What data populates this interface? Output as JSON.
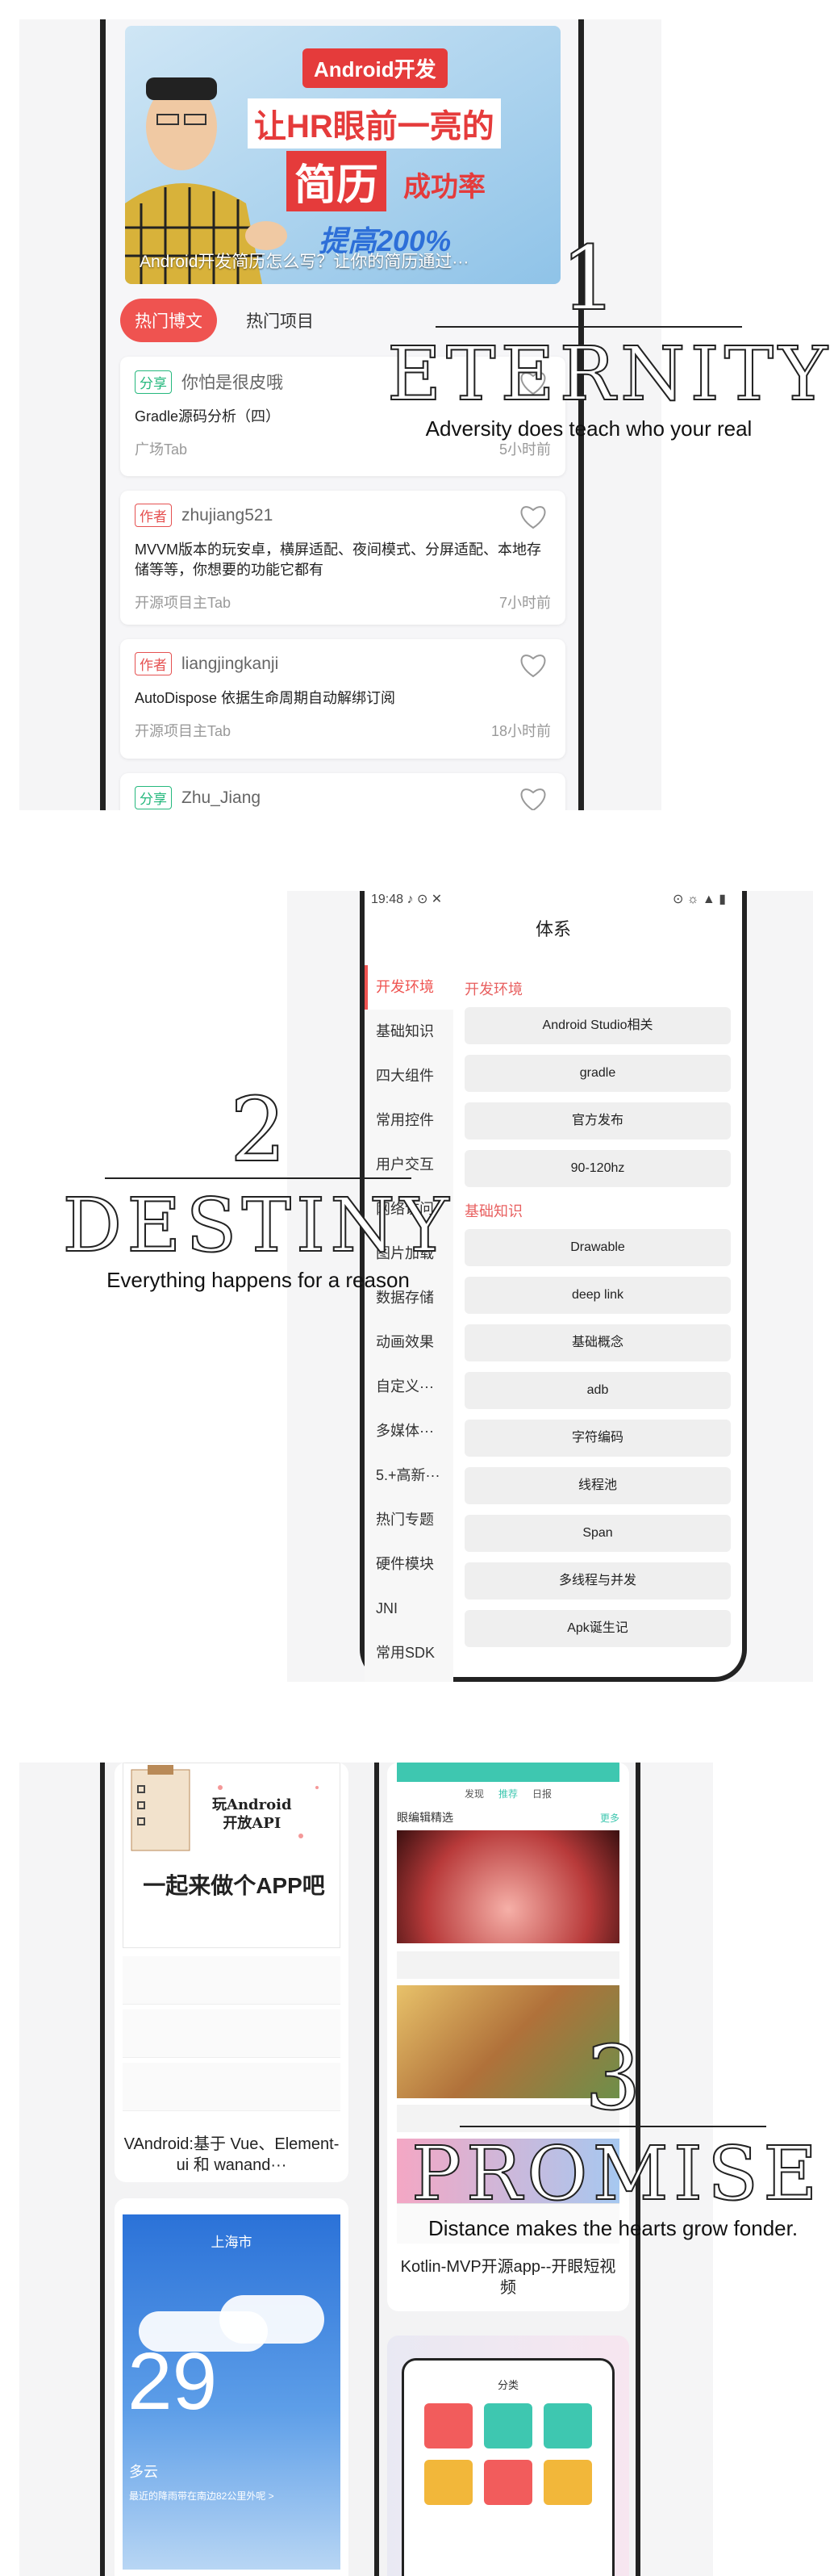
{
  "section1": {
    "banner": {
      "tag": "Android开发",
      "line1": "让HR眼前一亮的",
      "line2": "简历",
      "line2b": "成功率",
      "line3": "提高200%",
      "caption": "Android开发简历怎么写？让你的简历通过···"
    },
    "tabs": [
      "热门博文",
      "热门项目"
    ],
    "cards": [
      {
        "badge": "分享",
        "badge_type": "share",
        "user": "你怕是很皮哦",
        "title": "Gradle源码分析（四）",
        "source": "广场Tab",
        "time": "5小时前"
      },
      {
        "badge": "作者",
        "badge_type": "author",
        "user": "zhujiang521",
        "title": "MVVM版本的玩安卓，横屏适配、夜间模式、分屏适配、本地存储等等，你想要的功能它都有",
        "source": "开源项目主Tab",
        "time": "7小时前"
      },
      {
        "badge": "作者",
        "badge_type": "author",
        "user": "liangjingkanji",
        "title": "AutoDispose  依据生命周期自动解绑订阅",
        "source": "开源项目主Tab",
        "time": "18小时前"
      },
      {
        "badge": "分享",
        "badge_type": "share",
        "user": "Zhu_Jiang",
        "title": "",
        "source": "",
        "time": ""
      }
    ],
    "overlay": {
      "number": "1",
      "word": "ETERNITY",
      "subtitle": "Adversity does teach who your real"
    }
  },
  "section2": {
    "status_time": "19:48",
    "status_icons": "♪ ⊙ ✕",
    "status_right": "⊙ ☼ ▲ ▮",
    "header": "体系",
    "sidebar": [
      "开发环境",
      "基础知识",
      "四大组件",
      "常用控件",
      "用户交互",
      "网络访问",
      "图片加载",
      "数据存储",
      "动画效果",
      "自定义···",
      "多媒体···",
      "5.+高新···",
      "热门专题",
      "硬件模块",
      "JNI",
      "常用SDK"
    ],
    "groups": [
      {
        "title": "开发环境",
        "items": [
          "Android Studio相关",
          "gradle",
          "官方发布",
          "90-120hz"
        ]
      },
      {
        "title": "基础知识",
        "items": [
          "Drawable",
          "deep link",
          "基础概念",
          "adb",
          "字符编码",
          "线程池",
          "Span",
          "多线程与并发",
          "Apk诞生记"
        ]
      }
    ],
    "overlay": {
      "number": "2",
      "word": "DESTINY",
      "subtitle": "Everything happens for a reason"
    }
  },
  "section3": {
    "left_cards": [
      {
        "title": "VAndroid:基于 Vue、Element-ui 和 wanand···",
        "poster_title": "玩Android\n开放API",
        "poster_sub": "一起来做个APP吧"
      },
      {
        "title": "",
        "city": "上海市",
        "temp": "29",
        "weather": "多云",
        "note": "最近的降雨带在南边82公里外呢 >"
      }
    ],
    "right_cards": [
      {
        "title": "Kotlin-MVP开源app--开眼短视频",
        "tabs": [
          "发现",
          "推荐",
          "日报"
        ],
        "section": "眼编辑精选",
        "more": "更多"
      },
      {
        "title": "",
        "header": "分类"
      }
    ],
    "overlay": {
      "number": "3",
      "word": "PROMISE",
      "subtitle": "Distance makes the hearts grow fonder."
    }
  },
  "colors": {
    "accent": "#ef5350",
    "share": "#25b87d",
    "author": "#e55151",
    "teal": "#3ec7b0"
  }
}
